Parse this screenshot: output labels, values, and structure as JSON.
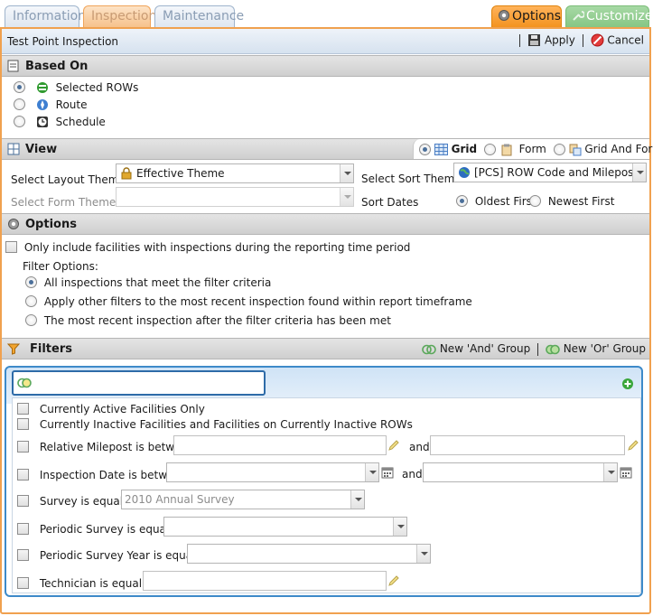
{
  "tabs": [
    {
      "label": "Information"
    },
    {
      "label": "Inspection"
    },
    {
      "label": "Maintenance"
    }
  ],
  "right_tabs": {
    "options": "Options",
    "customize": "Customize"
  },
  "header": {
    "title": "Test Point Inspection",
    "apply": "Apply",
    "cancel": "Cancel"
  },
  "based_on": {
    "heading": "Based On",
    "options": [
      {
        "label": "Selected ROWs",
        "selected": true
      },
      {
        "label": "Route",
        "selected": false
      },
      {
        "label": "Schedule",
        "selected": false
      }
    ]
  },
  "view": {
    "heading": "View",
    "modes": [
      {
        "label": "Grid",
        "selected": true
      },
      {
        "label": "Form",
        "selected": false
      },
      {
        "label": "Grid And Form",
        "selected": false
      }
    ],
    "layout_theme_label": "Select Layout Theme",
    "layout_theme_value": "Effective Theme",
    "form_theme_label": "Select Form Theme",
    "form_theme_value": "",
    "sort_theme_label": "Select Sort Theme",
    "sort_theme_value": "[PCS] ROW Code and Milepost",
    "sort_dates_label": "Sort Dates",
    "sort_dates": [
      {
        "label": "Oldest First",
        "selected": true
      },
      {
        "label": "Newest First",
        "selected": false
      }
    ]
  },
  "options": {
    "heading": "Options",
    "only_include_label": "Only include facilities with inspections during the reporting time period",
    "filter_options_label": "Filter Options:",
    "filter_options": [
      {
        "label": "All inspections that meet the filter criteria",
        "selected": true
      },
      {
        "label": "Apply other filters to the most recent inspection found within report timeframe",
        "selected": false
      },
      {
        "label": "The most recent inspection after the filter criteria has been met",
        "selected": false
      }
    ]
  },
  "filters": {
    "heading": "Filters",
    "new_and_group": "New 'And' Group",
    "new_or_group": "New 'Or' Group",
    "items": {
      "active": "Currently Active Facilities Only",
      "inactive": "Currently Inactive Facilities and Facilities on Currently Inactive ROWs",
      "milepost": "Relative Milepost is between",
      "inspection_date": "Inspection Date is between",
      "survey": "Survey is equal to",
      "survey_value": "2010 Annual Survey",
      "periodic_survey": "Periodic Survey is equal to",
      "periodic_survey_year": "Periodic Survey Year is equal to",
      "technician": "Technician is equal to",
      "and": "and"
    }
  },
  "colors": {
    "accent_orange": "#f0a14f",
    "filter_blue": "#3d8ac9"
  }
}
